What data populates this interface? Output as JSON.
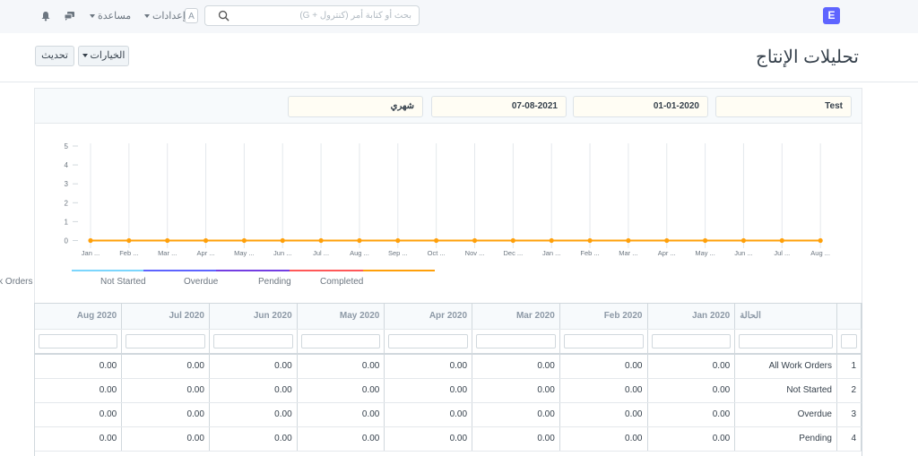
{
  "navbar": {
    "brand_letter": "E",
    "search_placeholder": "بحث أو كتابة أمر (كنترول + G)",
    "avatar_letter": "A",
    "settings_label": "إعدادات",
    "help_label": "مساعدة"
  },
  "page": {
    "title": "تحليلات الإنتاج",
    "options_label": "الخيارات",
    "refresh_label": "تحديث"
  },
  "filters": {
    "company": "Test",
    "from_date": "01-01-2020",
    "to_date": "07-08-2021",
    "range": "شهري"
  },
  "chart_data": {
    "type": "line",
    "x_labels": [
      "Jan ...",
      "Feb ...",
      "Mar ...",
      "Apr ...",
      "May ...",
      "Jun ...",
      "Jul ...",
      "Aug ...",
      "Sep ...",
      "Oct ...",
      "Nov ...",
      "Dec ...",
      "Jan ...",
      "Feb ...",
      "Mar ...",
      "Apr ...",
      "May ...",
      "Jun ...",
      "Jul ...",
      "Aug ..."
    ],
    "y_ticks": [
      0,
      1,
      2,
      3,
      4,
      5
    ],
    "ylim": [
      0,
      5
    ],
    "series": [
      {
        "name": "All Work Orders",
        "color": "#7cd6fd",
        "values": [
          0,
          0,
          0,
          0,
          0,
          0,
          0,
          0,
          0,
          0,
          0,
          0,
          0,
          0,
          0,
          0,
          0,
          0,
          0,
          0
        ]
      },
      {
        "name": "Not Started",
        "color": "#5e64ff",
        "values": [
          0,
          0,
          0,
          0,
          0,
          0,
          0,
          0,
          0,
          0,
          0,
          0,
          0,
          0,
          0,
          0,
          0,
          0,
          0,
          0
        ]
      },
      {
        "name": "Overdue",
        "color": "#743ee2",
        "values": [
          0,
          0,
          0,
          0,
          0,
          0,
          0,
          0,
          0,
          0,
          0,
          0,
          0,
          0,
          0,
          0,
          0,
          0,
          0,
          0
        ]
      },
      {
        "name": "Pending",
        "color": "#ff5858",
        "values": [
          0,
          0,
          0,
          0,
          0,
          0,
          0,
          0,
          0,
          0,
          0,
          0,
          0,
          0,
          0,
          0,
          0,
          0,
          0,
          0
        ]
      },
      {
        "name": "Completed",
        "color": "#ffa00a",
        "values": [
          0,
          0,
          0,
          0,
          0,
          0,
          0,
          0,
          0,
          0,
          0,
          0,
          0,
          0,
          0,
          0,
          0,
          0,
          0,
          0
        ]
      }
    ],
    "legend": [
      "Work Orders",
      "Not Started",
      "Overdue",
      "Pending",
      "Completed"
    ],
    "grid": true
  },
  "table": {
    "status_header": "الحالة",
    "month_headers": [
      "Jan 2020",
      "Feb 2020",
      "Mar 2020",
      "Apr 2020",
      "May 2020",
      "Jun 2020",
      "Jul 2020",
      "Aug 2020"
    ],
    "rows": [
      {
        "num": "1",
        "status": "All Work Orders",
        "values": [
          "0.00",
          "0.00",
          "0.00",
          "0.00",
          "0.00",
          "0.00",
          "0.00",
          "0.00"
        ]
      },
      {
        "num": "2",
        "status": "Not Started",
        "values": [
          "0.00",
          "0.00",
          "0.00",
          "0.00",
          "0.00",
          "0.00",
          "0.00",
          "0.00"
        ]
      },
      {
        "num": "3",
        "status": "Overdue",
        "values": [
          "0.00",
          "0.00",
          "0.00",
          "0.00",
          "0.00",
          "0.00",
          "0.00",
          "0.00"
        ]
      },
      {
        "num": "4",
        "status": "Pending",
        "values": [
          "0.00",
          "0.00",
          "0.00",
          "0.00",
          "0.00",
          "0.00",
          "0.00",
          "0.00"
        ]
      }
    ]
  }
}
